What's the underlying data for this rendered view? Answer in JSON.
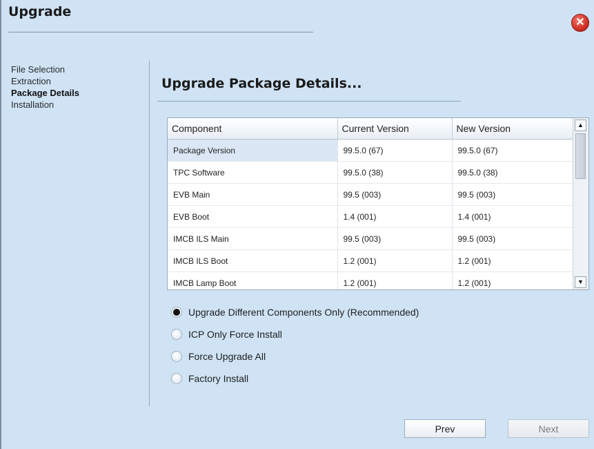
{
  "window": {
    "title": "Upgrade",
    "close_icon": "close-icon"
  },
  "steps": [
    {
      "label": "File Selection",
      "active": false
    },
    {
      "label": "Extraction",
      "active": false
    },
    {
      "label": "Package Details",
      "active": true
    },
    {
      "label": "Installation",
      "active": false
    }
  ],
  "main": {
    "heading": "Upgrade Package Details..."
  },
  "grid": {
    "columns": [
      "Component",
      "Current Version",
      "New Version"
    ],
    "rows": [
      [
        "Package Version",
        "99.5.0 (67)",
        "99.5.0 (67)"
      ],
      [
        "TPC Software",
        "99.5.0 (38)",
        "99.5.0 (38)"
      ],
      [
        "EVB Main",
        "99.5 (003)",
        "99.5 (003)"
      ],
      [
        "EVB Boot",
        "1.4 (001)",
        "1.4 (001)"
      ],
      [
        "IMCB ILS Main",
        "99.5 (003)",
        "99.5 (003)"
      ],
      [
        "IMCB ILS Boot",
        "1.2 (001)",
        "1.2 (001)"
      ],
      [
        "IMCB Lamp Boot",
        "1.2 (001)",
        "1.2 (001)"
      ]
    ]
  },
  "options": [
    {
      "label": "Upgrade Different Components Only (Recommended)",
      "selected": true
    },
    {
      "label": "ICP Only Force Install",
      "selected": false
    },
    {
      "label": "Force Upgrade All",
      "selected": false
    },
    {
      "label": "Factory Install",
      "selected": false
    }
  ],
  "buttons": {
    "prev": "Prev",
    "next": "Next"
  },
  "colors": {
    "window_bg": "#cfe3f5",
    "close_red": "#c8261b"
  }
}
